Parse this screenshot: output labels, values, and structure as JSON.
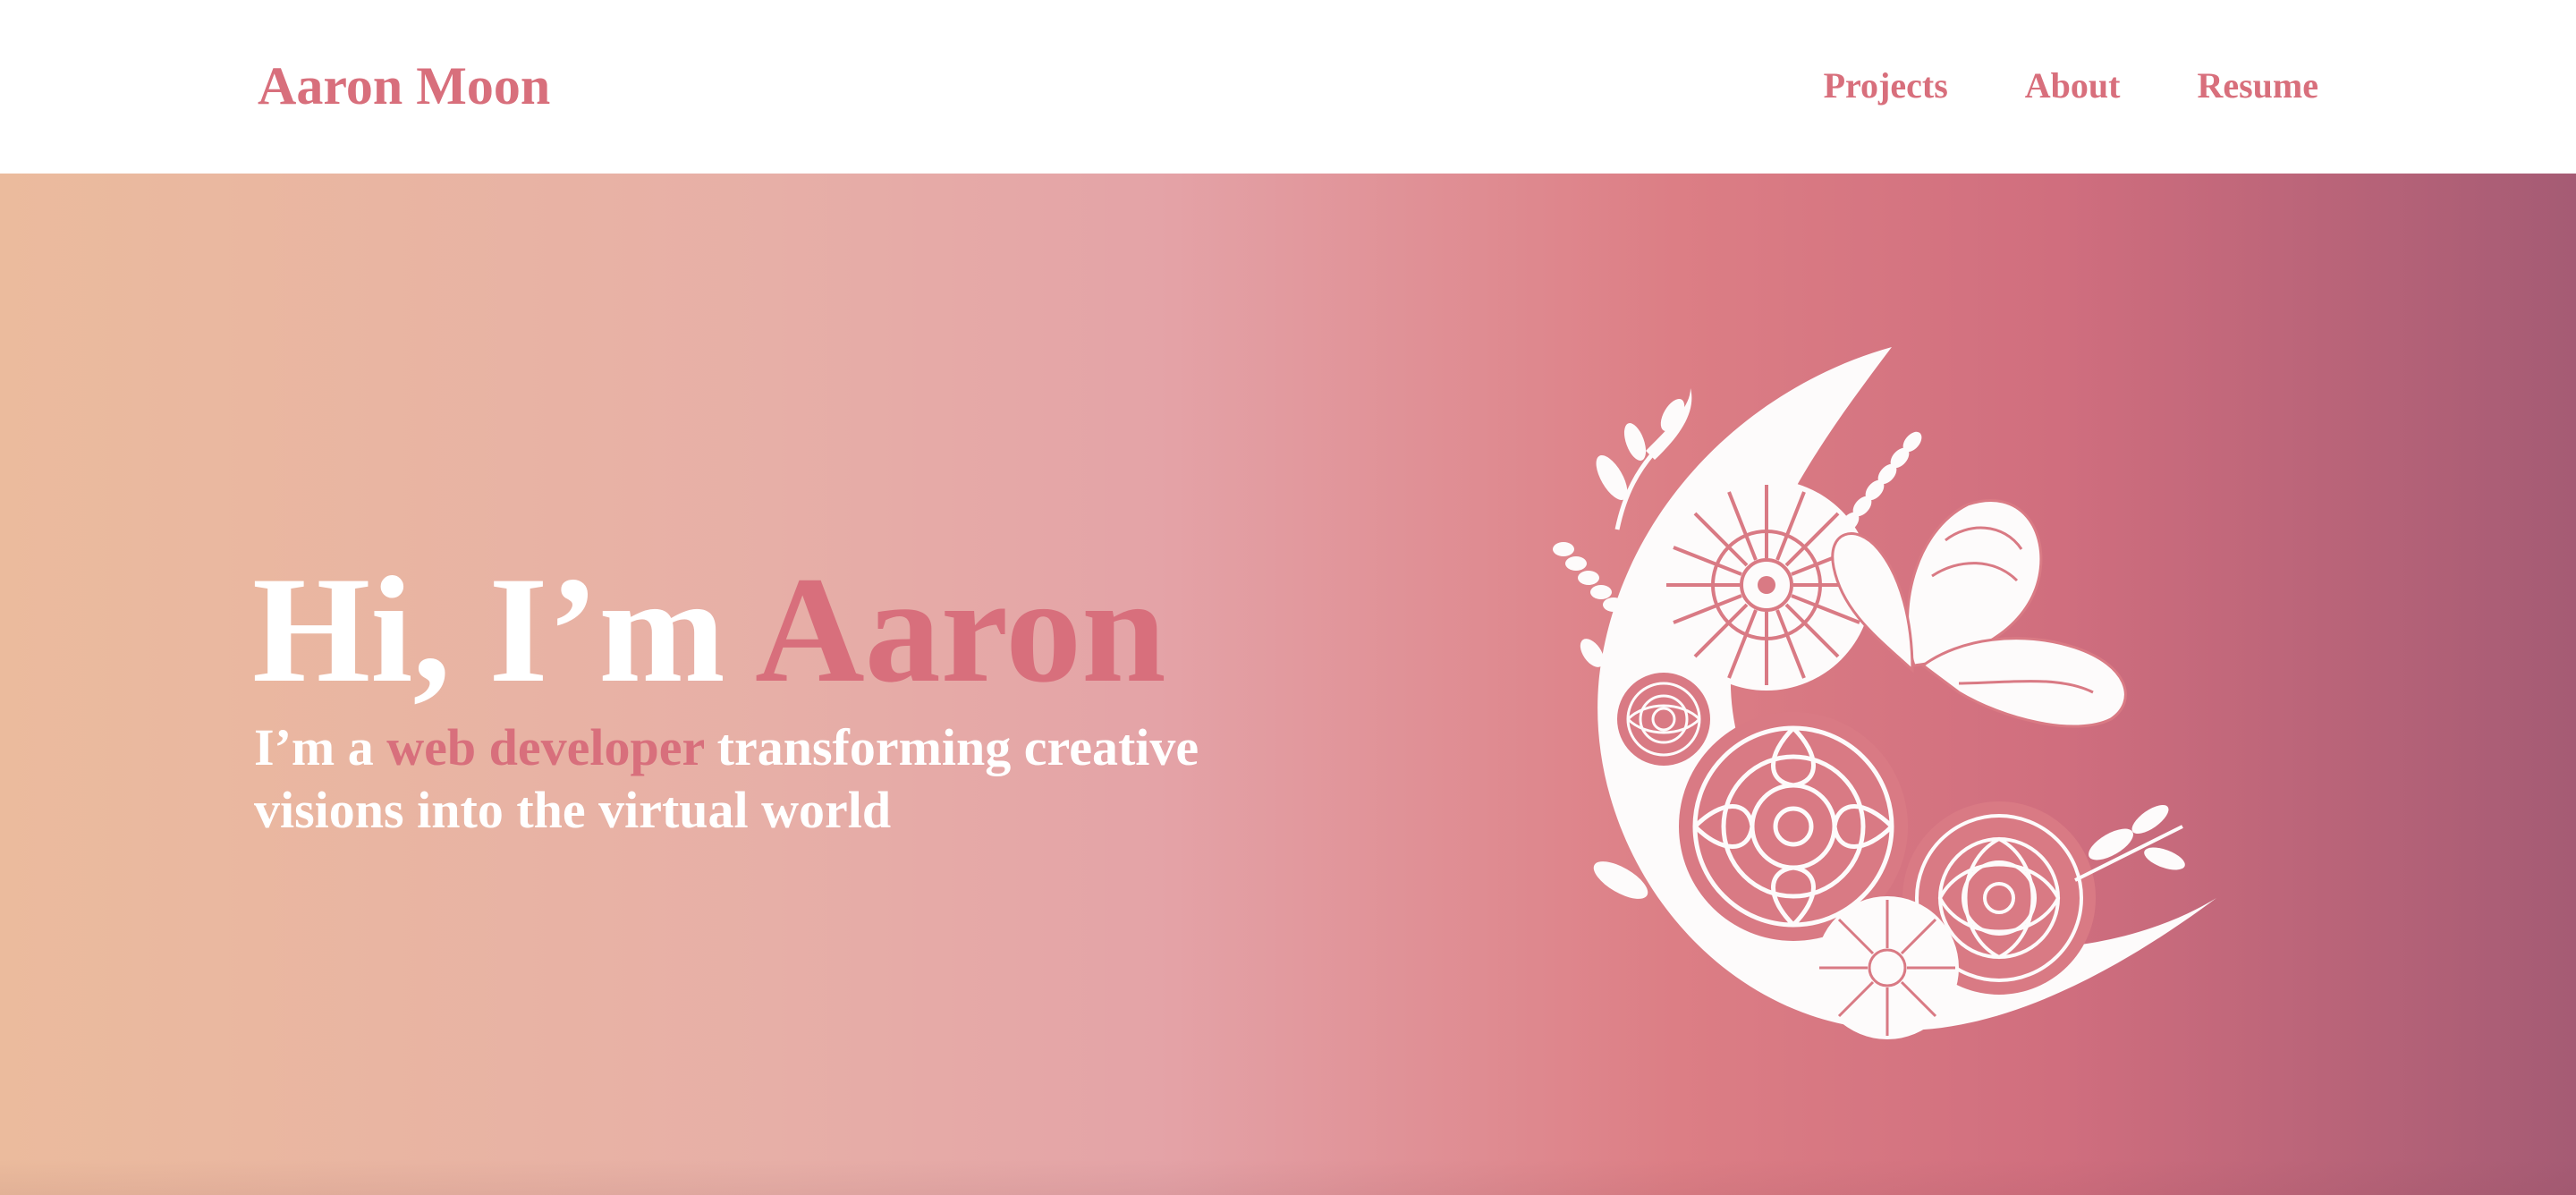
{
  "nav": {
    "brand": "Aaron Moon",
    "links": [
      "Projects",
      "About",
      "Resume"
    ]
  },
  "hero": {
    "greeting": "Hi, I’m ",
    "name": "Aaron",
    "tagline_prefix": "I’m a ",
    "tagline_role": "web developer",
    "tagline_suffix": " transforming creative visions into the virtual world",
    "illustration": "moon-with-flowers-and-butterfly-illustration"
  },
  "colors": {
    "accent": "#d86f7c",
    "gradient_start": "#ebbb9d",
    "gradient_end": "#a55b74",
    "text_light": "#ffffff",
    "nav_background": "#ffffff"
  }
}
